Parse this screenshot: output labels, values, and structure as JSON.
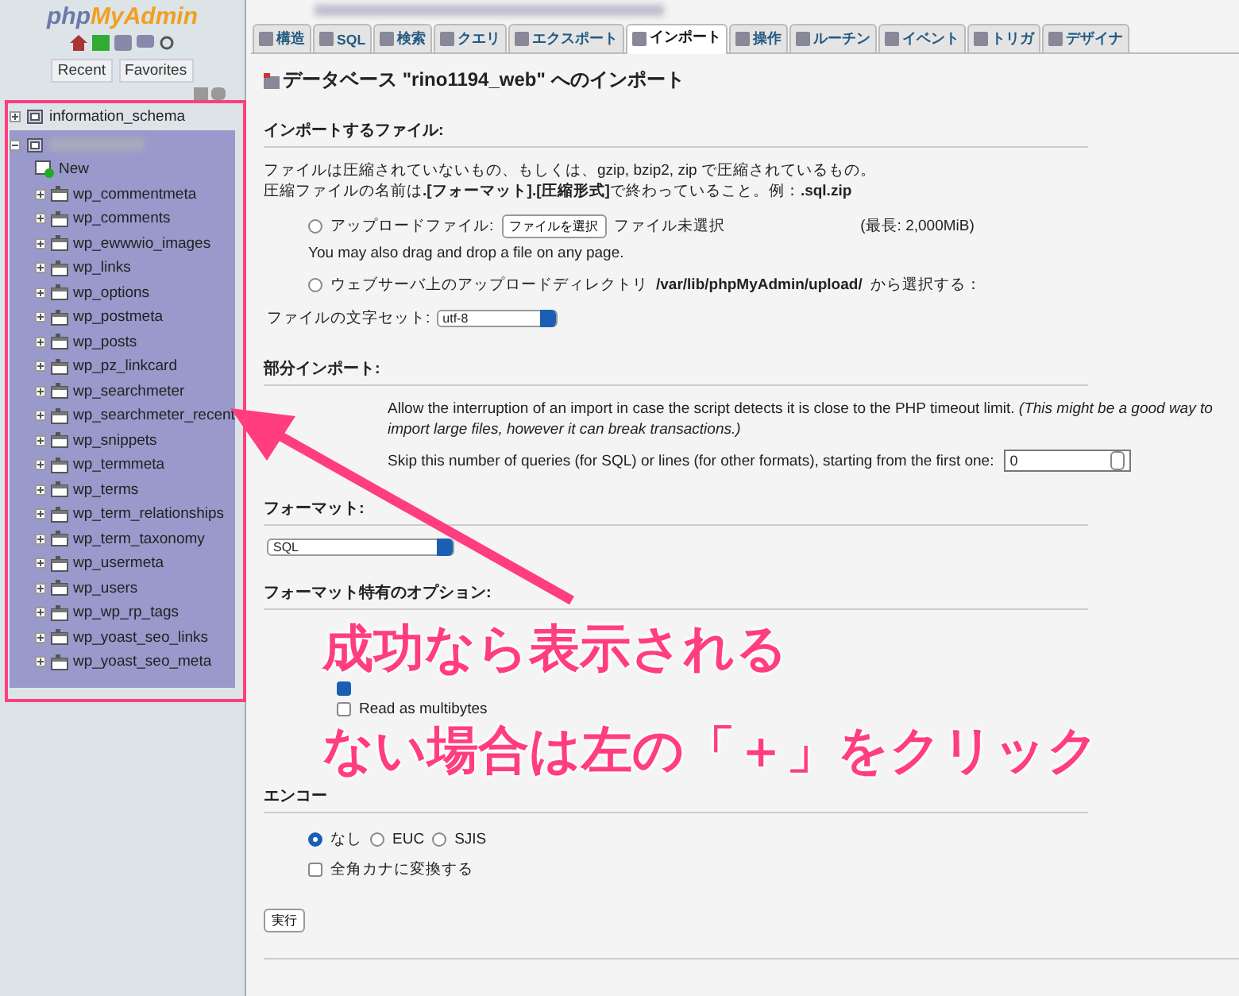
{
  "sidebar": {
    "logo": [
      "php",
      "MyAdmin"
    ],
    "buttons": [
      {
        "label": "Recent"
      },
      {
        "label": "Favorites"
      }
    ],
    "tree": [
      {
        "label": "information_schema",
        "expanded": false,
        "selected": false
      },
      {
        "blurred": true,
        "expanded": true,
        "selected": true,
        "children": [
          {
            "kind": "new",
            "label": "New"
          },
          {
            "kind": "table",
            "label": "wp_commentmeta"
          },
          {
            "kind": "table",
            "label": "wp_comments"
          },
          {
            "kind": "table",
            "label": "wp_ewwwio_images"
          },
          {
            "kind": "table",
            "label": "wp_links"
          },
          {
            "kind": "table",
            "label": "wp_options"
          },
          {
            "kind": "table",
            "label": "wp_postmeta"
          },
          {
            "kind": "table",
            "label": "wp_posts"
          },
          {
            "kind": "table",
            "label": "wp_pz_linkcard"
          },
          {
            "kind": "table",
            "label": "wp_searchmeter"
          },
          {
            "kind": "table",
            "label": "wp_searchmeter_recent"
          },
          {
            "kind": "table",
            "label": "wp_snippets"
          },
          {
            "kind": "table",
            "label": "wp_termmeta"
          },
          {
            "kind": "table",
            "label": "wp_terms"
          },
          {
            "kind": "table",
            "label": "wp_term_relationships"
          },
          {
            "kind": "table",
            "label": "wp_term_taxonomy"
          },
          {
            "kind": "table",
            "label": "wp_usermeta"
          },
          {
            "kind": "table",
            "label": "wp_users"
          },
          {
            "kind": "table",
            "label": "wp_wp_rp_tags"
          },
          {
            "kind": "table",
            "label": "wp_yoast_seo_links"
          },
          {
            "kind": "table",
            "label": "wp_yoast_seo_meta"
          }
        ]
      }
    ]
  },
  "tabs": [
    {
      "label": "構造",
      "selected": false
    },
    {
      "label": "SQL",
      "selected": false
    },
    {
      "label": "検索",
      "selected": false
    },
    {
      "label": "クエリ",
      "selected": false
    },
    {
      "label": "エクスポート",
      "selected": false
    },
    {
      "label": "インポート",
      "selected": true
    },
    {
      "label": "操作",
      "selected": false
    },
    {
      "label": "ルーチン",
      "selected": false
    },
    {
      "label": "イベント",
      "selected": false
    },
    {
      "label": "トリガ",
      "selected": false
    },
    {
      "label": "デザイナ",
      "selected": false
    }
  ],
  "title": "データベース \"rino1194_web\" へのインポート",
  "import_file": {
    "heading": "インポートするファイル:",
    "notes": [
      "ファイルは圧縮されていないもの、もしくは、gzip, bzip2, zip で圧縮されているもの。",
      "圧縮ファイルの名前は**.[フォーマット].[圧縮形式]**で終わっていること。例：**.sql.zip**"
    ],
    "options": [
      {
        "kind": "upload",
        "label": "アップロードファイル:",
        "selected": false,
        "button": "ファイルを選択",
        "file_status": "ファイル未選択",
        "limit": "(最長: 2,000MiB)",
        "hint": "You may also drag and drop a file on any page."
      },
      {
        "kind": "directory",
        "label": "ウェブサーバ上のアップロードディレクトリ",
        "path": "/var/lib/phpMyAdmin/upload/",
        "suffix": "から選択する：",
        "selected": false
      }
    ],
    "charset": {
      "label": "ファイルの文字セット:",
      "value": "utf-8"
    }
  },
  "partial_import": {
    "heading": "部分インポート:",
    "allow": "Allow the interruption of an import in case the script detects it is close to the PHP timeout limit. *(This might be a good way to import large files, however it can break transactions.)*",
    "skip": {
      "label": "Skip this number of queries (for SQL) or lines (for other formats), starting from the first one:",
      "value": "0"
    }
  },
  "format": {
    "heading": "フォーマット:",
    "value": "SQL"
  },
  "format_options": {
    "heading": "フォーマット特有のオプション:",
    "checks": [
      {
        "checked": true
      },
      {
        "label": "Read as multibytes",
        "checked": false
      }
    ]
  },
  "encoding": {
    "heading": "エンコー",
    "radios": [
      {
        "label": "なし",
        "selected": true
      },
      {
        "label": "EUC",
        "selected": false
      },
      {
        "label": "SJIS",
        "selected": false
      }
    ],
    "kana": {
      "label": "全角カナに変換する",
      "checked": false
    }
  },
  "submit": "実行",
  "annotation": {
    "lines": [
      "成功なら表示される",
      "ない場合は左の「＋」をクリック"
    ]
  }
}
